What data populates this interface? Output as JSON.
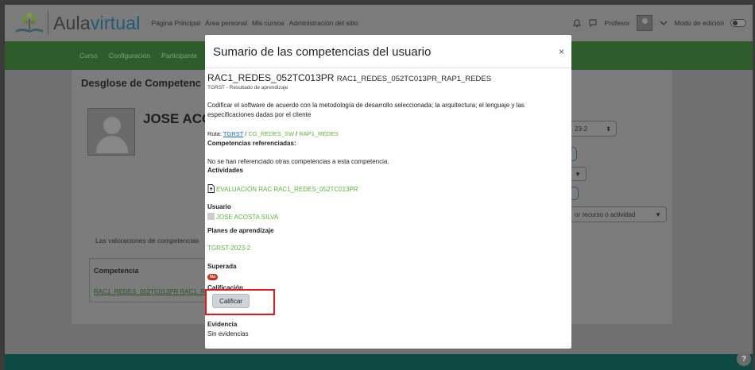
{
  "navbar": {
    "brand_prefix": "Aula",
    "brand_suffix": "virtual",
    "links": [
      "Página Principal",
      "Área personal",
      "Mis cursos",
      "Administración del sitio"
    ],
    "user_name": "Profesor",
    "edit_mode_label": "Modo de edición"
  },
  "secondary_nav": {
    "items": [
      "Curso",
      "Configuración",
      "Participante"
    ]
  },
  "background": {
    "card_title": "Desglose de Competenc",
    "user_name": "JOSE ACO",
    "assessment_text": "Las valoraciones de competencias",
    "table_header": "Competencia",
    "table_link": "RAC1_REDES_052TC013PR RAC1_R",
    "select_term": "23-2",
    "select_filter": "or recurso o actividad"
  },
  "modal": {
    "title": "Sumario de las competencias del usuario",
    "close_symbol": "×",
    "competency_idnumber": "RAC1_REDES_052TC013PR",
    "competency_name": "RAC1_REDES_052TC013PR_RAP1_REDES",
    "framework_subtitle": "TGRST - Resultado de aprendizaje",
    "description": "Codificar el software de acuerdo con la metodología de desarrollo seleccionada; la arquitectura; el lenguaje y las especificaciones dadas por el cliente",
    "path_label": "Ruta:",
    "path": [
      "TGRST",
      "CG_REDES_SW",
      "RAP1_REDES"
    ],
    "path_sep": " / ",
    "referenced_heading": "Competencias referenciadas:",
    "referenced_text": "No se han referenciado otras competencias a esta competencia.",
    "activities_heading": "Actividades",
    "activity_link": "EVALUACIÓN RAC RAC1_REDES_052TC013PR",
    "user_heading": "Usuario",
    "user_link": "JOSE ACOSTA SILVA",
    "plans_heading": "Planes de aprendizaje",
    "plan_link": "TGRST-2023-2",
    "proficient_heading": "Superada",
    "proficient_badge": "No",
    "rating_heading": "Calificación",
    "rate_button": "Calificar",
    "evidence_heading": "Evidencia",
    "evidence_text": "Sin evidencias"
  },
  "help_button": "?",
  "colors": {
    "link_green": "#5cb53a",
    "link_blue": "#0f6cbf",
    "badge_red": "#ca3120",
    "highlight_red": "#e5161a",
    "footer_teal": "#0d4a43"
  }
}
